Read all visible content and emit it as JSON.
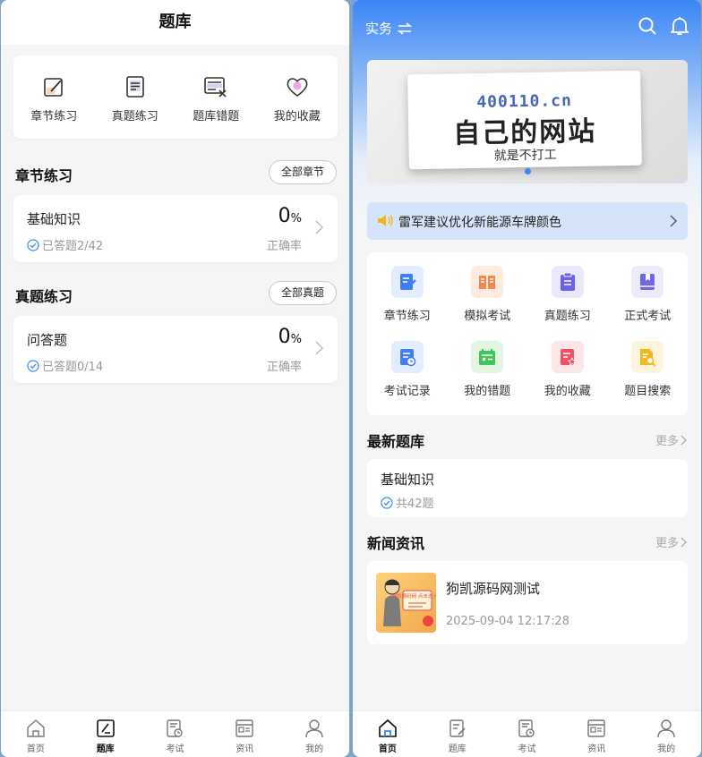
{
  "left": {
    "header_title": "题库",
    "quick_actions": [
      {
        "label": "章节练习",
        "icon": "edit-icon"
      },
      {
        "label": "真题练习",
        "icon": "document-icon"
      },
      {
        "label": "题库错题",
        "icon": "wrong-answer-icon"
      },
      {
        "label": "我的收藏",
        "icon": "heart-icon"
      }
    ],
    "sections": [
      {
        "title": "章节练习",
        "button": "全部章节",
        "card": {
          "name": "基础知识",
          "progress": "已答题2/42",
          "percent": "0",
          "percent_unit": "%",
          "accuracy_label": "正确率"
        }
      },
      {
        "title": "真题练习",
        "button": "全部真题",
        "card": {
          "name": "问答题",
          "progress": "已答题0/14",
          "percent": "0",
          "percent_unit": "%",
          "accuracy_label": "正确率"
        }
      }
    ],
    "active_tab": 1
  },
  "right": {
    "location": "实务",
    "banner": {
      "site": "400110.cn",
      "headline": "自己的网站",
      "subline": "就是不打工"
    },
    "notice": "雷军建议优化新能源车牌颜色",
    "grid": [
      {
        "label": "章节练习",
        "icon": "edit-icon",
        "bg": "#e4edfd",
        "fg": "#3f7ff0"
      },
      {
        "label": "模拟考试",
        "icon": "book-open-icon",
        "bg": "#fdebdd",
        "fg": "#f2894a"
      },
      {
        "label": "真题练习",
        "icon": "clipboard-icon",
        "bg": "#eae9fb",
        "fg": "#6a62e8"
      },
      {
        "label": "正式考试",
        "icon": "bookmark-book-icon",
        "bg": "#eceafb",
        "fg": "#6f67e6"
      },
      {
        "label": "考试记录",
        "icon": "record-icon",
        "bg": "#e4edfd",
        "fg": "#3f7ff0"
      },
      {
        "label": "我的错题",
        "icon": "calendar-wrong-icon",
        "bg": "#e3f6e4",
        "fg": "#43c45a"
      },
      {
        "label": "我的收藏",
        "icon": "favorite-doc-icon",
        "bg": "#fde6e8",
        "fg": "#ef5166"
      },
      {
        "label": "题目搜索",
        "icon": "search-doc-icon",
        "bg": "#fdf4dc",
        "fg": "#f3b81f"
      }
    ],
    "latest": {
      "title": "最新题库",
      "more": "更多",
      "item": {
        "name": "基础知识",
        "count": "共42题"
      }
    },
    "news": {
      "title": "新闻资讯",
      "more": "更多",
      "item": {
        "title": "狗凯源码网测试",
        "time": "2025-09-04 12:17:28",
        "thumb_caption": "狗凯源码网 点击进入一"
      }
    },
    "active_tab": 0
  },
  "tabs": [
    {
      "label": "首页",
      "icon": "home-icon"
    },
    {
      "label": "题库",
      "icon": "question-bank-icon"
    },
    {
      "label": "考试",
      "icon": "exam-icon"
    },
    {
      "label": "资讯",
      "icon": "news-icon"
    },
    {
      "label": "我的",
      "icon": "user-icon"
    }
  ],
  "colors": {
    "primary": "#3b86f5",
    "notice_bg": "#d5e4f8"
  }
}
